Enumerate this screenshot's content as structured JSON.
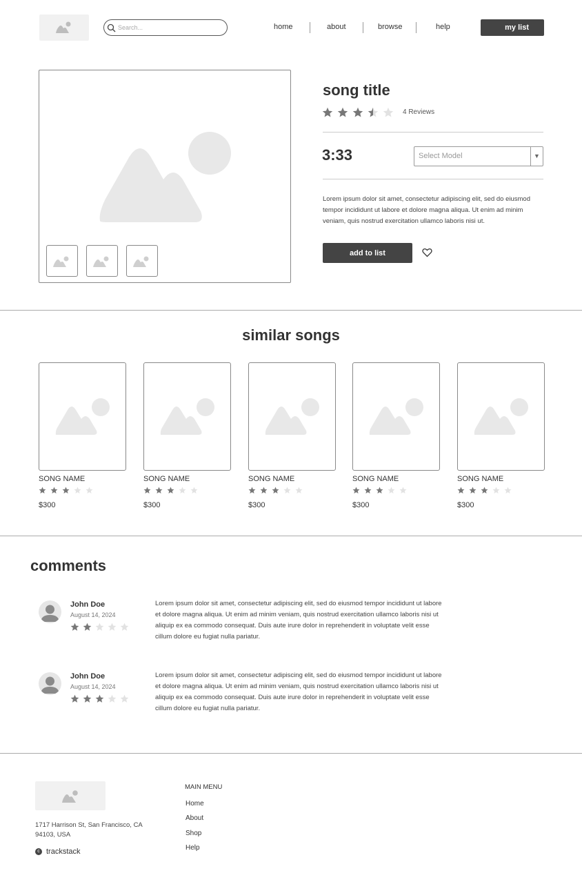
{
  "header": {
    "search_placeholder": "Search...",
    "nav": [
      "home",
      "about",
      "browse",
      "help"
    ],
    "my_list": "my list"
  },
  "product": {
    "title": "song title",
    "rating": 3.5,
    "reviews": "4 Reviews",
    "duration": "3:33",
    "select_placeholder": "Select Model",
    "description": "Lorem ipsum dolor sit amet, consectetur adipiscing elit, sed do eiusmod tempor incididunt ut labore et dolore magna aliqua. Ut enim ad minim veniam, quis nostrud exercitation ullamco laboris nisi ut.",
    "add_button": "add to list"
  },
  "similar": {
    "title": "similar songs",
    "items": [
      {
        "name": "SONG NAME",
        "rating": 3,
        "price": "$300"
      },
      {
        "name": "SONG NAME",
        "rating": 3,
        "price": "$300"
      },
      {
        "name": "SONG NAME",
        "rating": 3,
        "price": "$300"
      },
      {
        "name": "SONG NAME",
        "rating": 3,
        "price": "$300"
      },
      {
        "name": "SONG NAME",
        "rating": 3,
        "price": "$300"
      }
    ]
  },
  "comments": {
    "title": "comments",
    "items": [
      {
        "name": "John Doe",
        "date": "August 14, 2024",
        "rating": 2,
        "text": "Lorem ipsum dolor sit amet, consectetur adipiscing elit, sed do eiusmod tempor incididunt ut labore et dolore magna aliqua. Ut enim ad minim veniam, quis nostrud exercitation ullamco laboris nisi ut aliquip ex ea commodo consequat. Duis aute irure dolor in reprehenderit in voluptate velit esse cillum dolore eu fugiat nulla pariatur."
      },
      {
        "name": "John Doe",
        "date": "August 14, 2024",
        "rating": 3,
        "text": "Lorem ipsum dolor sit amet, consectetur adipiscing elit, sed do eiusmod tempor incididunt ut labore et dolore magna aliqua. Ut enim ad minim veniam, quis nostrud exercitation ullamco laboris nisi ut aliquip ex ea commodo consequat. Duis aute irure dolor in reprehenderit in voluptate velit esse cillum dolore eu fugiat nulla pariatur."
      }
    ]
  },
  "footer": {
    "address": "1717 Harrison St, San Francisco, CA 94103, USA",
    "brand": "trackstack",
    "menu_title": "MAIN MENU",
    "menu": [
      "Home",
      "About",
      "Shop",
      "Help"
    ]
  },
  "colors": {
    "star_filled": "#777777",
    "star_empty": "#e2e2e2",
    "button_dark": "#444444",
    "placeholder_fill": "#e8e8e8"
  }
}
